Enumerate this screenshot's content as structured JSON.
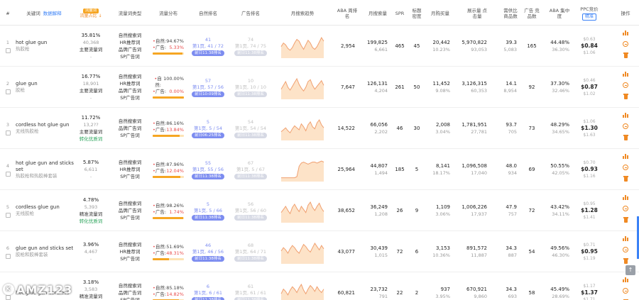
{
  "header": {
    "idx": "#",
    "keyword": "关键词",
    "keyword_link": "数据解释",
    "flow_tag": "流量词",
    "flow_title": "流量占比",
    "flow_sort": "↓",
    "type": "流量词类型",
    "dist": "流量分布",
    "organic_rank": "自然排名",
    "ad_rank": "广告排名",
    "trend": "月搜索趋势",
    "aba": "ABA 周排名",
    "monthly_search": "月搜索量",
    "spr": "SPR",
    "title_density": "标题 密度",
    "monthly_buy": "月购买量",
    "impressions": "展示量 点击量",
    "goods": "需供比 商品数",
    "ad_goods": "广告 竞品数",
    "aba_conc": "ABA 集中度",
    "ppc": "PPC竞价",
    "ppc_sel": "精准",
    "ops": "操作"
  },
  "rows": [
    {
      "idx": "1",
      "kw": "hot glue gun",
      "kw_cn": "热胶枪",
      "share": "35.81%",
      "share_num": "40,368",
      "share_label": "主要流量词",
      "share_extra": "-",
      "types": [
        "自然搜索词",
        "HR推荐词",
        "品牌广告词",
        "SP广告词"
      ],
      "organic_label": "自然:",
      "organic": "94.67%",
      "ad_label": "广告:",
      "ad": "5.33%",
      "organic_frac": 0.9467,
      "r_top": "41",
      "r_mid": "第1页, 41 / 72",
      "r_pill": "前日11:38排名",
      "a_top": "74",
      "a_mid": "第1页, 74 / 75",
      "a_pill": "前日11:38排名",
      "trend": [
        12,
        16,
        14,
        10,
        8,
        11,
        16,
        20,
        18,
        13,
        9,
        14,
        19,
        16,
        11,
        9,
        12,
        17,
        22,
        18
      ],
      "aba": "2,954",
      "search": "199,825",
      "search2": "6,661",
      "spr": "465",
      "density": "45",
      "buy": "20,442",
      "buy2": "10.23%",
      "imp": "5,970,822",
      "imp2": "93,053",
      "ratio": "39.3",
      "ratio2": "5,083",
      "adc": "165",
      "conc": "44.48%",
      "conc2": "36.30%",
      "ppc_top": "$0.63",
      "ppc_mid": "$0.84",
      "ppc_bot": "$1.06"
    },
    {
      "idx": "2",
      "kw": "glue gun",
      "kw_cn": "胶枪",
      "share": "16.77%",
      "share_num": "18,901",
      "share_label": "主要流量词",
      "share_extra": "-",
      "types": [
        "自然搜索词",
        "HR推荐词",
        "品牌广告词",
        "SP广告词"
      ],
      "organic_label": "自然:",
      "organic": "100.00%",
      "ad_label": "广告:",
      "ad": "0.00%",
      "organic_frac": 1.0,
      "r_top": "57",
      "r_mid": "第1页, 57 / 56",
      "r_pill": "前日10:09排名",
      "a_top": "10",
      "a_mid": "第1页, 10 / 10",
      "a_pill": "前日11:38排名",
      "trend": [
        10,
        14,
        18,
        12,
        9,
        13,
        17,
        21,
        15,
        11,
        8,
        12,
        18,
        20,
        14,
        10,
        13,
        16,
        19,
        14
      ],
      "aba": "7,647",
      "search": "126,131",
      "search2": "4,204",
      "spr": "261",
      "density": "50",
      "buy": "11,452",
      "buy2": "9.08%",
      "imp": "3,126,315",
      "imp2": "60,353",
      "ratio": "14.1",
      "ratio2": "8,954",
      "adc": "92",
      "conc": "37.30%",
      "conc2": "32.46%",
      "ppc_top": "$0.46",
      "ppc_mid": "$0.87",
      "ppc_bot": "$1.02"
    },
    {
      "idx": "3",
      "kw": "cordless hot glue gun",
      "kw_cn": "无线热胶枪",
      "share": "11.72%",
      "share_num": "13,2??",
      "share_label": "主要流量词",
      "share_extra": "转化优质词",
      "types": [
        "自然搜索词",
        "品牌广告词",
        "SP广告词"
      ],
      "organic_label": "自然:",
      "organic": "86.16%",
      "ad_label": "广告:",
      "ad": "13.84%",
      "organic_frac": 0.8616,
      "r_top": "5",
      "r_mid": "第1页, 5 / 54",
      "r_pill": "前日06:25排名",
      "a_top": "54",
      "a_mid": "第1页, 54 / 54",
      "a_pill": "前日11:38排名",
      "trend": [
        8,
        10,
        12,
        9,
        7,
        11,
        14,
        12,
        10,
        16,
        13,
        9,
        15,
        18,
        13,
        11,
        17,
        20,
        15,
        12
      ],
      "aba": "14,522",
      "search": "66,056",
      "search2": "2,202",
      "spr": "46",
      "density": "30",
      "buy": "2,008",
      "buy2": "3.04%",
      "imp": "1,781,951",
      "imp2": "27,781",
      "ratio": "93.7",
      "ratio2": "705",
      "adc": "73",
      "conc": "48.29%",
      "conc2": "34.65%",
      "ppc_top": "$1.06",
      "ppc_mid": "$1.30",
      "ppc_bot": "$1.63"
    },
    {
      "idx": "4",
      "kw": "hot glue gun and sticks set",
      "kw_cn": "热胶枪和热胶棒套装",
      "share": "5.87%",
      "share_num": "6,611",
      "share_label": "",
      "share_extra": "-",
      "types": [
        "自然搜索词",
        "HR推荐词",
        "SP广告词"
      ],
      "organic_label": "自然:",
      "organic": "87.96%",
      "ad_label": "广告:",
      "ad": "12.04%",
      "organic_frac": 0.8796,
      "r_top": "55",
      "r_mid": "第1页, 55 / 56",
      "r_pill": "前日11:38排名",
      "a_top": "67",
      "a_mid": "第1页, 5 / 67",
      "a_pill": "前日11:38排名",
      "trend": [
        3,
        3,
        3,
        3,
        3,
        3,
        3,
        4,
        14,
        17,
        18,
        17,
        16,
        17,
        18,
        18,
        17,
        18,
        19,
        18
      ],
      "aba": "25,964",
      "search": "44,807",
      "search2": "1,494",
      "spr": "185",
      "density": "5",
      "buy": "8,141",
      "buy2": "18.17%",
      "imp": "1,096,508",
      "imp2": "17,040",
      "ratio": "48.0",
      "ratio2": "934",
      "adc": "69",
      "conc": "50.55%",
      "conc2": "42.05%",
      "ppc_top": "$0.70",
      "ppc_mid": "$0.93",
      "ppc_bot": "$1.16"
    },
    {
      "idx": "5",
      "kw": "cordless glue gun",
      "kw_cn": "无线胶枪",
      "share": "4.78%",
      "share_num": "5,393",
      "share_label": "精准流量词",
      "share_extra": "转化优质词",
      "types": [
        "自然搜索词",
        "品牌广告词",
        "SP广告词"
      ],
      "organic_label": "自然:",
      "organic": "98.26%",
      "ad_label": "广告:",
      "ad": "1.74%",
      "organic_frac": 0.9826,
      "r_top": "5",
      "r_mid": "第1页, 5 / 66",
      "r_pill": "前日11:38排名",
      "a_top": "56",
      "a_mid": "第1页, 56 / 60",
      "a_pill": "前日11:38排名",
      "trend": [
        9,
        12,
        15,
        11,
        8,
        14,
        17,
        13,
        10,
        15,
        12,
        9,
        16,
        19,
        14,
        11,
        15,
        18,
        13,
        10
      ],
      "aba": "38,652",
      "search": "36,249",
      "search2": "1,208",
      "spr": "26",
      "density": "9",
      "buy": "1,109",
      "buy2": "3.06%",
      "imp": "1,006,226",
      "imp2": "17,937",
      "ratio": "47.9",
      "ratio2": "757",
      "adc": "72",
      "conc": "43.42%",
      "conc2": "34.11%",
      "ppc_top": "$0.95",
      "ppc_mid": "$1.28",
      "ppc_bot": "$1.41"
    },
    {
      "idx": "6",
      "kw": "glue gun and sticks set",
      "kw_cn": "胶枪和胶棒套装",
      "share": "3.96%",
      "share_num": "4,467",
      "share_label": "",
      "share_extra": "-",
      "types": [
        "自然搜索词",
        "HR推荐词",
        "SP广告词"
      ],
      "organic_label": "自然:",
      "organic": "51.69%",
      "ad_label": "广告:",
      "ad": "48.31%",
      "organic_frac": 0.5169,
      "r_top": "46",
      "r_mid": "第1页, 46 / 56",
      "r_pill": "前日11:38排名",
      "a_top": "68",
      "a_mid": "第1页, 64 / 71",
      "a_pill": "前日11:38排名",
      "trend": [
        11,
        14,
        12,
        9,
        13,
        16,
        14,
        11,
        9,
        13,
        17,
        15,
        12,
        10,
        14,
        18,
        15,
        12,
        16,
        13
      ],
      "aba": "43,077",
      "search": "30,439",
      "search2": "1,015",
      "spr": "72",
      "density": "6",
      "buy": "3,153",
      "buy2": "10.36%",
      "imp": "891,572",
      "imp2": "11,887",
      "ratio": "34.3",
      "ratio2": "887",
      "adc": "54",
      "conc": "49.56%",
      "conc2": "46.30%",
      "ppc_top": "$0.71",
      "ppc_mid": "$0.95",
      "ppc_bot": "$1.19"
    },
    {
      "idx": "7",
      "kw": "hot glue gun cordless",
      "kw_cn": "",
      "share": "3.18%",
      "share_num": "3,583",
      "share_label": "精准流量词",
      "share_extra": "转化优质词",
      "types": [
        "自然搜索词",
        "品牌广告词",
        "SP广告词"
      ],
      "organic_label": "自然:",
      "organic": "85.18%",
      "ad_label": "广告:",
      "ad": "14.82%",
      "organic_frac": 0.8518,
      "r_top": "6",
      "r_mid": "第1页, 6 / 61",
      "r_pill": "前日11:38排名",
      "a_top": "61",
      "a_mid": "第1页, 61 / 61",
      "a_pill": "前日11:38排名",
      "trend": [
        9,
        13,
        11,
        8,
        12,
        15,
        13,
        10,
        14,
        17,
        12,
        9,
        13,
        16,
        14,
        11,
        15,
        12,
        10,
        13
      ],
      "aba": "60,821",
      "search": "23,732",
      "search2": "791",
      "spr": "22",
      "density": "2",
      "buy": "937",
      "buy2": "3.95%",
      "imp": "670,921",
      "imp2": "9,860",
      "ratio": "34.3",
      "ratio2": "693",
      "adc": "58",
      "conc": "45.49%",
      "conc2": "28.69%",
      "ppc_top": "$1.17",
      "ppc_mid": "$1.37",
      "ppc_bot": "$1.71"
    }
  ],
  "colors": {
    "accent": "#f08a24",
    "rank": "#7c8cf0",
    "bar": "#f6a623",
    "trend_fill": "#fde3c8",
    "trend_line": "#f0a070"
  },
  "watermark": "AMZ123",
  "back_top_icon": "up-arrow-icon"
}
